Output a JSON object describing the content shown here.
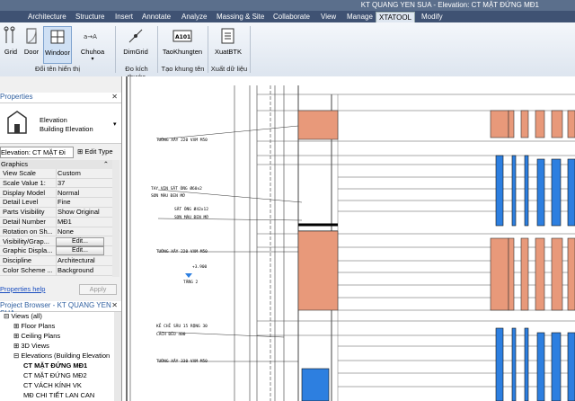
{
  "title_bar": {
    "text": "KT QUANG YEN SUA - Elevation: CT MẶT ĐỨNG MĐ1"
  },
  "ribbon_tabs": [
    "Architecture",
    "Structure",
    "Insert",
    "Annotate",
    "Analyze",
    "Massing & Site",
    "Collaborate",
    "View",
    "Manage",
    "XTATOOL",
    "Modify"
  ],
  "active_tab": "XTATOOL",
  "ribbon": {
    "grid": "Grid",
    "door": "Door",
    "windoor": "Windoor",
    "chuhoa": "Chuhoa",
    "group_hien_thi": "Đổi tên hiển thị",
    "dimgrid": "DimGrid",
    "group_kich_thuoc": "Đo kích thước",
    "taokhungten": "TaoKhungten",
    "group_khung_ten": "Tạo khung tên",
    "xuatbtk": "XuatBTK",
    "group_du_lieu": "Xuất dữ liệu",
    "a101": "A101"
  },
  "properties": {
    "header": "Properties",
    "type_line1": "Elevation",
    "type_line2": "Building Elevation",
    "selector": "Elevation: CT MẶT Đi",
    "edit_type": "Edit Type",
    "section": "Graphics",
    "rows": [
      {
        "k": "View Scale",
        "v": "Custom"
      },
      {
        "k": "Scale Value  1:",
        "v": "37"
      },
      {
        "k": "Display Model",
        "v": "Normal"
      },
      {
        "k": "Detail Level",
        "v": "Fine"
      },
      {
        "k": "Parts Visibility",
        "v": "Show Original"
      },
      {
        "k": "Detail Number",
        "v": "MĐ1"
      },
      {
        "k": "Rotation on Sh...",
        "v": "None"
      },
      {
        "k": "Visibility/Grap...",
        "v": ""
      },
      {
        "k": "Graphic Displa...",
        "v": ""
      },
      {
        "k": "Discipline",
        "v": "Architectural"
      },
      {
        "k": "Color Scheme ...",
        "v": "Background"
      }
    ],
    "edit_label": "Edit...",
    "help": "Properties help",
    "apply": "Apply"
  },
  "browser": {
    "header": "Project Browser - KT QUANG YEN SUA",
    "items": [
      {
        "label": "Views (all)",
        "level": 0,
        "bold": false
      },
      {
        "label": "Floor Plans",
        "level": 1,
        "bold": false
      },
      {
        "label": "Ceiling Plans",
        "level": 1,
        "bold": false
      },
      {
        "label": "3D Views",
        "level": 1,
        "bold": false
      },
      {
        "label": "Elevations (Building Elevation",
        "level": 1,
        "bold": false
      },
      {
        "label": "CT MẶT ĐỨNG MĐ1",
        "level": 2,
        "bold": true
      },
      {
        "label": "CT MẶT ĐỨNG MĐ2",
        "level": 2,
        "bold": false
      },
      {
        "label": "CT VÁCH KÍNH VK",
        "level": 2,
        "bold": false
      },
      {
        "label": "MĐ CHI TIẾT LAN CAN",
        "level": 2,
        "bold": false
      }
    ]
  },
  "drawing": {
    "annotations": [
      "TƯỜNG XÂY 220 VXM M50",
      "TAY VỊN SẮT ỐNG Ø60x2",
      "SƠN MÀU ĐEN MỜ",
      "SẮT ỐNG Ø42x12",
      "SƠN MÀU ĐEN MỜ",
      "TƯỜNG XÂY 220 VXM M50",
      "+3.900",
      "TẦNG 2",
      "KẺ CHỈ SÂU 15 RỘNG 30",
      "CÁCH ĐỀU 400",
      "TƯỜNG XÂY 330 VXM M50"
    ]
  },
  "colors": {
    "accent_brick": "#e8997a",
    "glass_blue": "#2d7fe0",
    "ribbon_tab_bg": "#3f5273"
  }
}
